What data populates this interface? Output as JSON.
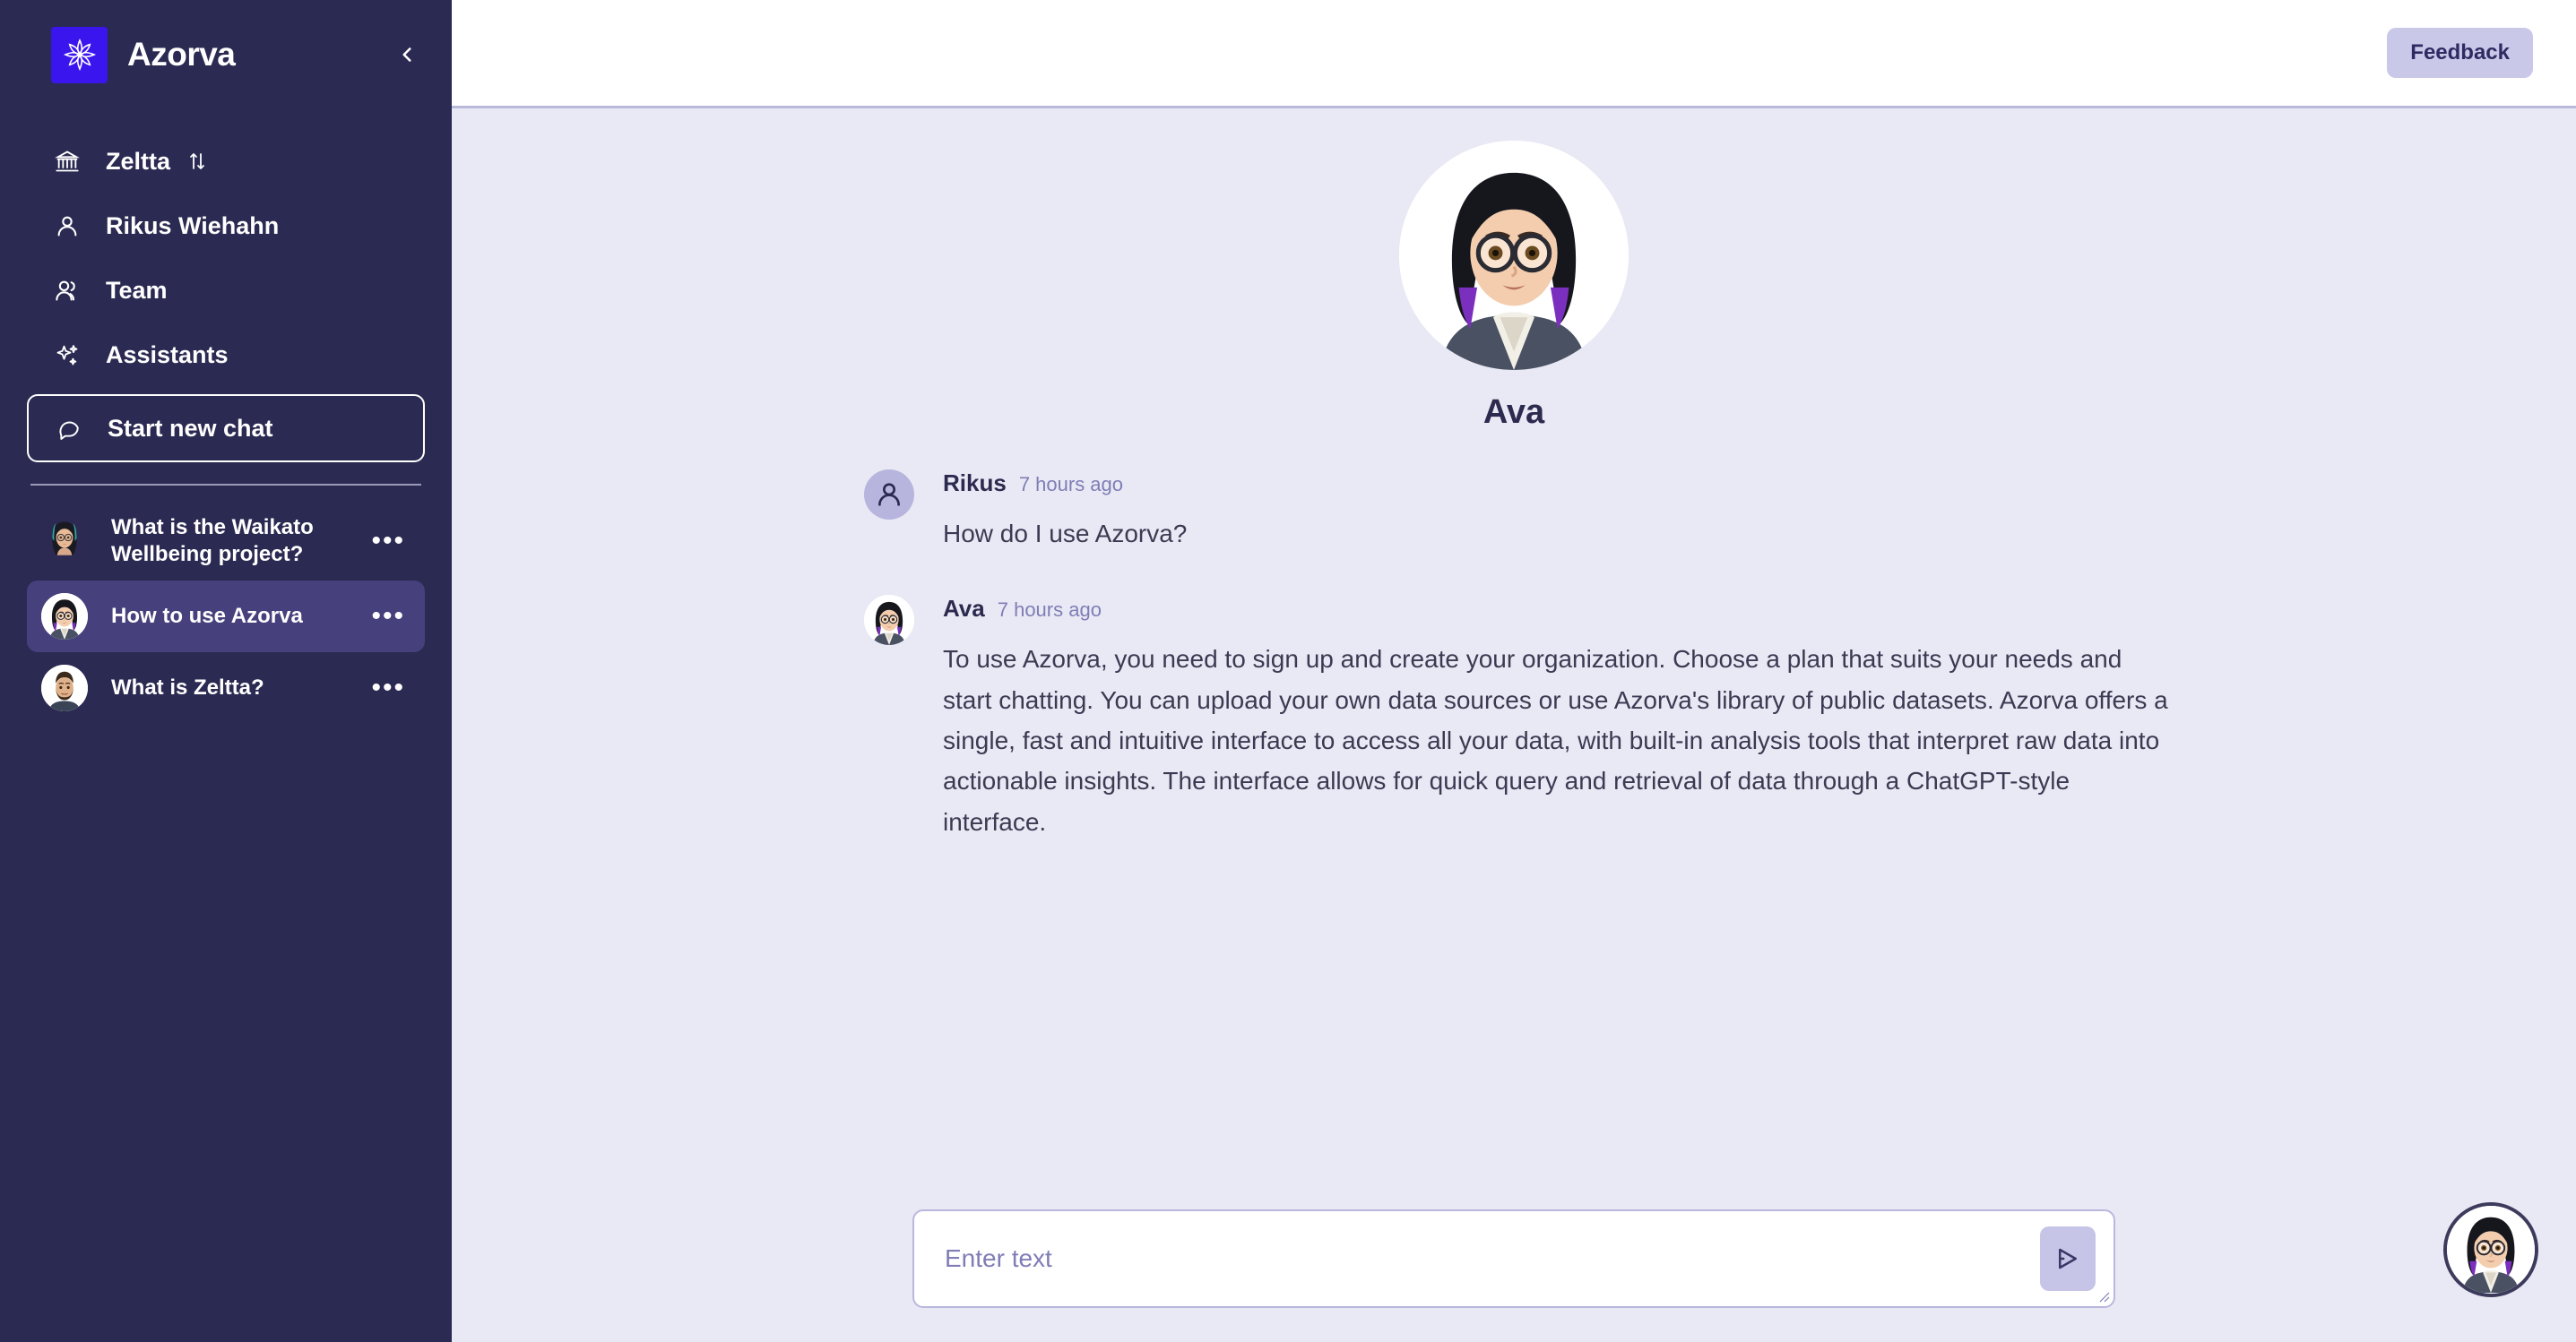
{
  "app": {
    "brand_name": "Azorva",
    "accent_logo_bg": "#3A15EE",
    "sidebar_bg": "#2B2A52",
    "selected_bg": "#46407C",
    "content_bg": "#E9E9F5"
  },
  "sidebar": {
    "collapse_icon": "chevron-left-icon",
    "nav": [
      {
        "label": "Zeltta",
        "icon": "bank-icon",
        "trailing_icon": "swap-vertical-icon"
      },
      {
        "label": "Rikus Wiehahn",
        "icon": "user-icon",
        "trailing_icon": ""
      },
      {
        "label": "Team",
        "icon": "users-icon",
        "trailing_icon": ""
      },
      {
        "label": "Assistants",
        "icon": "sparkles-icon",
        "trailing_icon": ""
      }
    ],
    "new_chat": {
      "label": "Start new chat",
      "icon": "chat-bubble-icon"
    },
    "chats": [
      {
        "title": "What is the Waikato Wellbeing project?",
        "avatar": "woman-teal-hair",
        "menu": "•••",
        "selected": false
      },
      {
        "title": "How to use Azorva",
        "avatar": "ava",
        "menu": "•••",
        "selected": true
      },
      {
        "title": "What is Zeltta?",
        "avatar": "man-beard",
        "menu": "•••",
        "selected": false
      }
    ]
  },
  "topbar": {
    "feedback_label": "Feedback"
  },
  "assistant": {
    "name": "Ava",
    "avatar": "ava"
  },
  "messages": [
    {
      "author": "Rikus",
      "time": "7 hours ago",
      "avatar_type": "user",
      "text": "How do I use Azorva?"
    },
    {
      "author": "Ava",
      "time": "7 hours ago",
      "avatar_type": "bot",
      "text": "To use Azorva, you need to sign up and create your organization. Choose a plan that suits your needs and start chatting. You can upload your own data sources or use Azorva's library of public datasets. Azorva offers a single, fast and intuitive interface to access all your data, with built-in analysis tools that interpret raw data into actionable insights. The interface allows for quick query and retrieval of data through a ChatGPT-style interface."
    }
  ],
  "composer": {
    "placeholder": "Enter text",
    "value": "",
    "send_icon": "send-triangle-icon"
  },
  "fab": {
    "icon": "ava-assistant-avatar"
  }
}
